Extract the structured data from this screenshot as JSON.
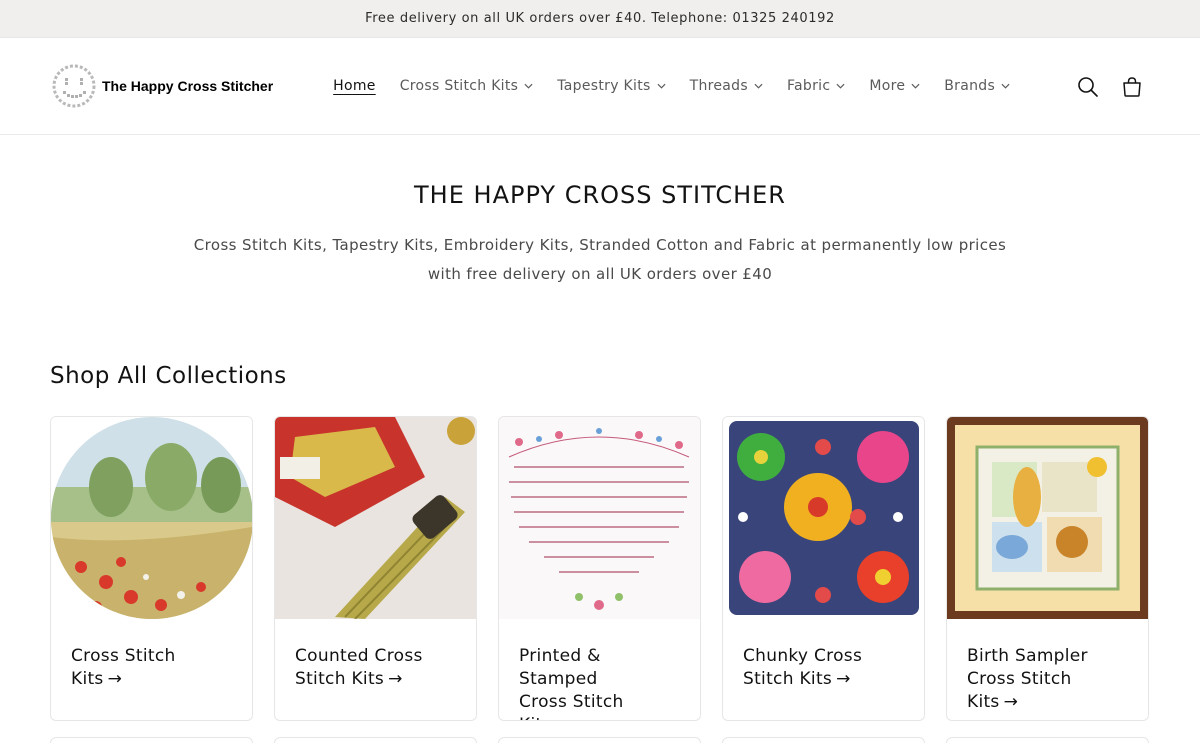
{
  "announcement": {
    "text": "Free delivery on all UK orders over £40. Telephone: 01325 240192"
  },
  "header": {
    "logo_text": "The Happy Cross Stitcher",
    "nav": [
      {
        "label": "Home"
      },
      {
        "label": "Cross Stitch Kits"
      },
      {
        "label": "Tapestry Kits"
      },
      {
        "label": "Threads"
      },
      {
        "label": "Fabric"
      },
      {
        "label": "More"
      },
      {
        "label": "Brands"
      }
    ],
    "icons": {
      "search": "search-icon",
      "cart": "cart-icon"
    }
  },
  "hero": {
    "title": "THE HAPPY CROSS STITCHER",
    "line1": "Cross Stitch Kits, Tapestry Kits, Embroidery Kits, Stranded Cotton and Fabric at permanently low prices",
    "line2": "with free delivery on all UK orders over £40"
  },
  "collections": {
    "title": "Shop All Collections",
    "items": [
      {
        "line1": "Cross Stitch Kits",
        "line2": ""
      },
      {
        "line1": "Counted Cross",
        "line2": "Stitch Kits"
      },
      {
        "line1": "Printed & Stamped",
        "line2": "Cross Stitch Kits"
      },
      {
        "line1": "Chunky Cross",
        "line2": "Stitch Kits"
      },
      {
        "line1": "Birth Sampler",
        "line2": "Cross Stitch Kits"
      }
    ],
    "arrow": "→"
  },
  "colors": {
    "announcement_bg": "#f0efee",
    "text": "#121212",
    "nav_text": "#5b5b5b"
  }
}
